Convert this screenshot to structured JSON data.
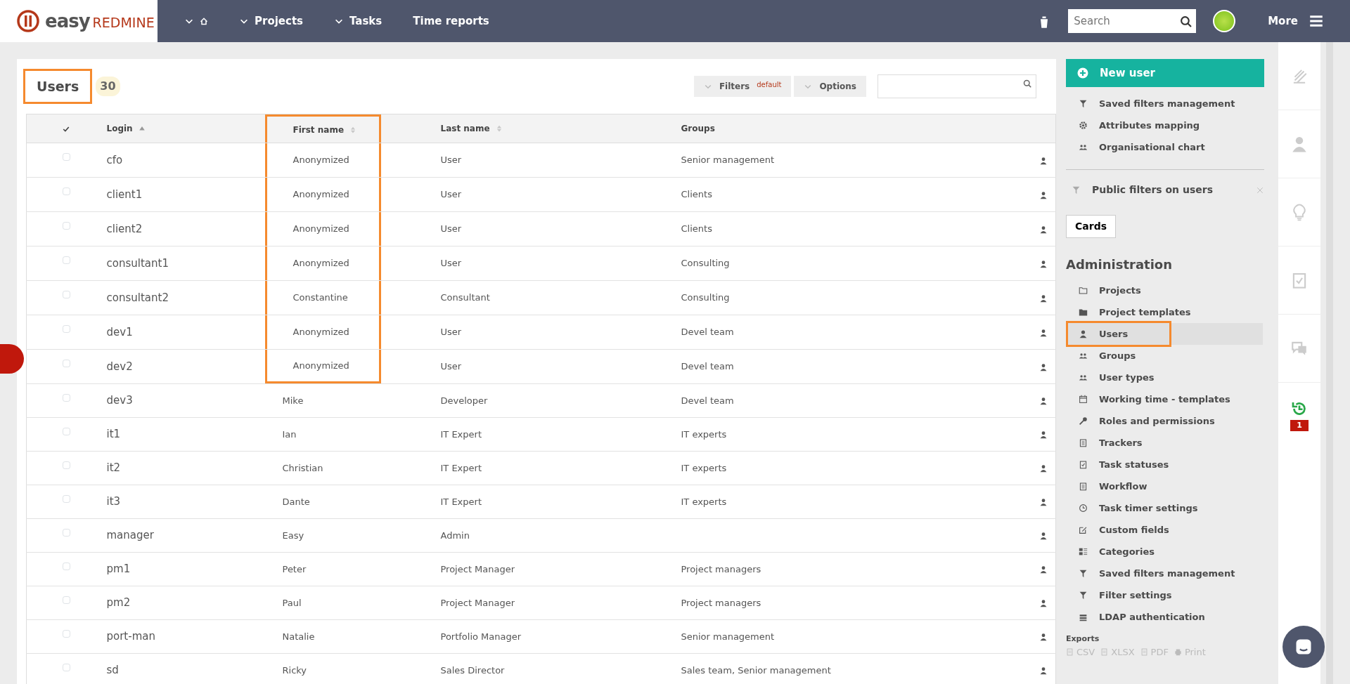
{
  "topbar": {
    "logo": {
      "brand": "easy",
      "product": "REDMINE"
    },
    "nav": [
      {
        "kind": "home"
      },
      {
        "kind": "dropdown",
        "label": "Projects"
      },
      {
        "kind": "dropdown",
        "label": "Tasks"
      },
      {
        "kind": "link",
        "label": "Time reports"
      }
    ],
    "search": {
      "placeholder": "Search"
    },
    "more": "More"
  },
  "page": {
    "title": "Users",
    "count": "30",
    "title_highlighted": true,
    "toolbar": {
      "filters": "Filters",
      "filters_tag": "default",
      "options": "Options"
    }
  },
  "table": {
    "columns": [
      {
        "kind": "check"
      },
      {
        "kind": "text",
        "label": "Login",
        "sorted": true,
        "sortable": true,
        "highlighted": false
      },
      {
        "kind": "text",
        "label": "First name",
        "sorted": false,
        "sortable": true,
        "highlighted": true
      },
      {
        "kind": "text",
        "label": "Last name",
        "sorted": false,
        "sortable": true,
        "highlighted": false
      },
      {
        "kind": "text",
        "label": "Groups",
        "sorted": false,
        "sortable": false,
        "highlighted": false
      }
    ],
    "rows": [
      {
        "checked": false,
        "login": "cfo",
        "first_name": "Anonymized",
        "last_name": "User",
        "groups": "Senior management",
        "highlighted": true
      },
      {
        "checked": false,
        "login": "client1",
        "first_name": "Anonymized",
        "last_name": "User",
        "groups": "Clients",
        "highlighted": true
      },
      {
        "checked": false,
        "login": "client2",
        "first_name": "Anonymized",
        "last_name": "User",
        "groups": "Clients",
        "highlighted": true
      },
      {
        "checked": false,
        "login": "consultant1",
        "first_name": "Anonymized",
        "last_name": "User",
        "groups": "Consulting",
        "highlighted": true
      },
      {
        "checked": false,
        "login": "consultant2",
        "first_name": "Constantine",
        "last_name": "Consultant",
        "groups": "Consulting",
        "highlighted": true
      },
      {
        "checked": false,
        "login": "dev1",
        "first_name": "Anonymized",
        "last_name": "User",
        "groups": "Devel team",
        "highlighted": true
      },
      {
        "checked": false,
        "login": "dev2",
        "first_name": "Anonymized",
        "last_name": "User",
        "groups": "Devel team",
        "highlighted": true
      },
      {
        "checked": false,
        "login": "dev3",
        "first_name": "Mike",
        "last_name": "Developer",
        "groups": "Devel team",
        "highlighted": false
      },
      {
        "checked": false,
        "login": "it1",
        "first_name": "Ian",
        "last_name": "IT Expert",
        "groups": "IT experts",
        "highlighted": false
      },
      {
        "checked": false,
        "login": "it2",
        "first_name": "Christian",
        "last_name": "IT Expert",
        "groups": "IT experts",
        "highlighted": false
      },
      {
        "checked": false,
        "login": "it3",
        "first_name": "Dante",
        "last_name": "IT Expert",
        "groups": "IT experts",
        "highlighted": false
      },
      {
        "checked": false,
        "login": "manager",
        "first_name": "Easy",
        "last_name": "Admin",
        "highlighted": false
      },
      {
        "checked": false,
        "login": "pm1",
        "first_name": "Peter",
        "last_name": "Project Manager",
        "groups": "Project managers",
        "highlighted": false
      },
      {
        "checked": false,
        "login": "pm2",
        "first_name": "Paul",
        "last_name": "Project Manager",
        "groups": "Project managers",
        "highlighted": false
      },
      {
        "checked": false,
        "login": "port-man",
        "first_name": "Natalie",
        "last_name": "Portfolio Manager",
        "groups": "Senior management",
        "highlighted": false
      },
      {
        "checked": false,
        "login": "sd",
        "first_name": "Ricky",
        "last_name": "Sales Director",
        "groups": "Sales team, Senior management",
        "highlighted": false
      }
    ]
  },
  "sidebar": {
    "new_user": "New user",
    "actions": [
      {
        "label": "Saved filters management"
      },
      {
        "label": "Attributes mapping"
      },
      {
        "label": "Organisational chart"
      }
    ],
    "public_filters": {
      "title": "Public filters on users",
      "button": "Cards"
    },
    "administration": {
      "title": "Administration",
      "items": [
        {
          "label": "Projects",
          "selected": false,
          "highlighted": false
        },
        {
          "label": "Project templates",
          "selected": false,
          "highlighted": false
        },
        {
          "label": "Users",
          "selected": true,
          "highlighted": true
        },
        {
          "label": "Groups",
          "selected": false,
          "highlighted": false
        },
        {
          "label": "User types",
          "selected": false,
          "highlighted": false
        },
        {
          "label": "Working time - templates",
          "selected": false,
          "highlighted": false
        },
        {
          "label": "Roles and permissions",
          "selected": false,
          "highlighted": false
        },
        {
          "label": "Trackers",
          "selected": false,
          "highlighted": false
        },
        {
          "label": "Task statuses",
          "selected": false,
          "highlighted": false
        },
        {
          "label": "Workflow",
          "selected": false,
          "highlighted": false
        },
        {
          "label": "Task timer settings",
          "selected": false,
          "highlighted": false
        },
        {
          "label": "Custom fields",
          "selected": false,
          "highlighted": false
        },
        {
          "label": "Categories",
          "selected": false,
          "highlighted": false
        },
        {
          "label": "Saved filters management",
          "selected": false,
          "highlighted": false
        },
        {
          "label": "Filter settings",
          "selected": false,
          "highlighted": false
        },
        {
          "label": "LDAP authentication",
          "selected": false,
          "highlighted": false
        }
      ]
    },
    "exports": {
      "title": "Exports",
      "items": [
        "CSV",
        "XLSX",
        "PDF",
        "Print"
      ]
    }
  },
  "rail": {
    "badge": "1"
  }
}
